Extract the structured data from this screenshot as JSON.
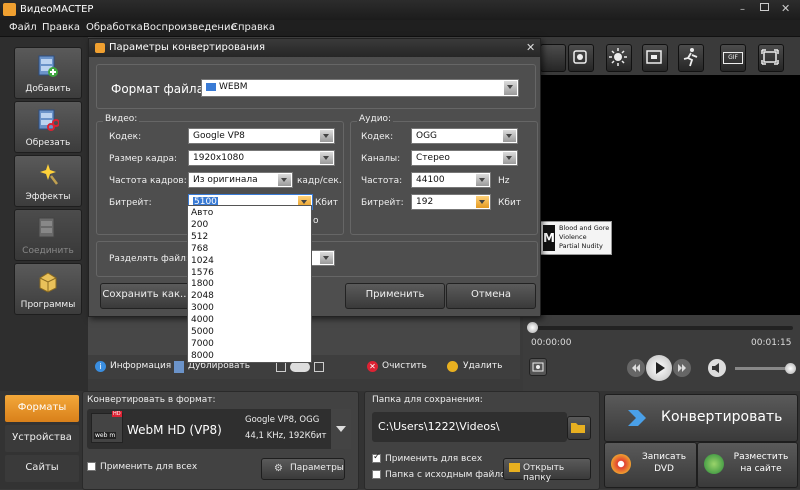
{
  "app": {
    "title": "ВидеоМАСТЕР"
  },
  "menu": [
    "Файл",
    "Правка",
    "Обработка",
    "Воспроизведение",
    "Справка"
  ],
  "sidebar": [
    {
      "label": "Добавить",
      "icon": "film-add-icon"
    },
    {
      "label": "Обрезать",
      "icon": "film-scissors-icon"
    },
    {
      "label": "Эффекты",
      "icon": "sparkle-wand-icon"
    },
    {
      "label": "Соединить",
      "icon": "film-join-icon"
    },
    {
      "label": "Программы",
      "icon": "programs-box-icon"
    }
  ],
  "dialog": {
    "title": "Параметры конвертирования",
    "format_label": "Формат файла:",
    "format_value": "WEBM",
    "video": {
      "group": "Видео:",
      "codec_label": "Кодек:",
      "codec": "Google VP8",
      "size_label": "Размер кадра:",
      "size": "1920x1080",
      "fps_label": "Частота кадров:",
      "fps": "Из оригинала",
      "fps_unit": "кадр/сек.",
      "bitrate_label": "Битрейт:",
      "bitrate": "5100",
      "bitrate_unit": "Кбит",
      "hidden_fragment": "о"
    },
    "audio": {
      "group": "Аудио:",
      "codec_label": "Кодек:",
      "codec": "OGG",
      "channels_label": "Каналы:",
      "channels": "Стерео",
      "freq_label": "Частота:",
      "freq": "44100",
      "freq_unit": "Hz",
      "bitrate_label": "Битрейт:",
      "bitrate": "192",
      "bitrate_unit": "Кбит"
    },
    "split_label": "Разделять файл:",
    "save_btn": "Сохранить как...",
    "apply_btn": "Применить",
    "cancel_btn": "Отмена",
    "bitrate_options": [
      "Авто",
      "200",
      "512",
      "768",
      "1024",
      "1576",
      "1800",
      "2048",
      "3000",
      "4000",
      "5000",
      "7000",
      "8000"
    ]
  },
  "toolbar": {
    "info": "Информация",
    "duplicate": "Дублировать",
    "clear": "Очистить",
    "delete": "Удалить"
  },
  "player": {
    "time_start": "00:00:00",
    "time_end": "00:01:15",
    "rating_lines": [
      "Blood and Gore",
      "Violence",
      "Partial Nudity"
    ],
    "rating_letter": "M"
  },
  "tabs": [
    "Форматы",
    "Устройства",
    "Сайты"
  ],
  "convert": {
    "header": "Конвертировать в формат:",
    "format_name": "WebM HD (VP8)",
    "badge_top": "HD",
    "badge_text": "web m",
    "details_line1": "Google VP8, OGG",
    "details_line2": "44,1 KHz, 192Кбит",
    "apply_all": "Применить для всех",
    "params_btn": "Параметры"
  },
  "save": {
    "header": "Папка для сохранения:",
    "path": "C:\\Users\\1222\\Videos\\",
    "apply_all": "Применить для всех",
    "source_folder": "Папка с исходным файлом",
    "open_btn": "Открыть папку"
  },
  "actions": {
    "convert": "Конвертировать",
    "burn": "Записать DVD",
    "publish": "Разместить на сайте"
  },
  "colors": {
    "accent": "#f0a030",
    "active_tab": "#e8951e"
  }
}
